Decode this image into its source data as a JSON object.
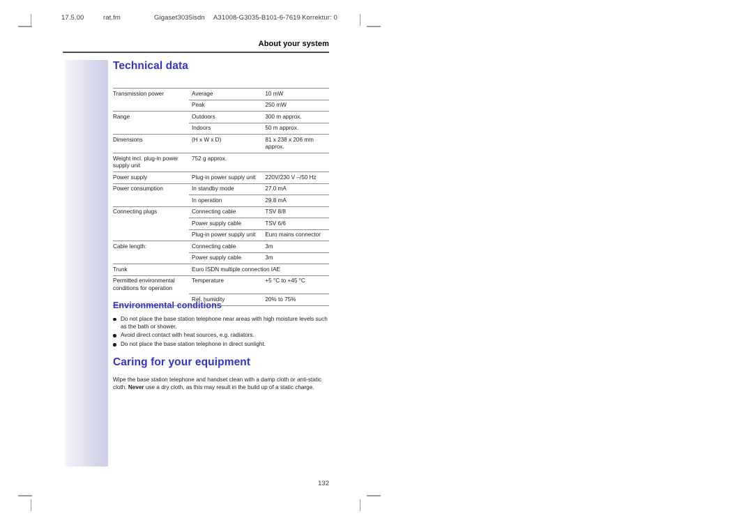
{
  "running_header": {
    "date": "17.5.00",
    "file": "rat.fm",
    "model": "Gigaset3035isdn",
    "doc_number": "A31008-G3035-B101-6-7619",
    "correction": "Korrektur: 0"
  },
  "chapter_title": "About your system",
  "page_number": "132",
  "accent_color": "#3333cc",
  "sections": {
    "technical_data": {
      "heading": "Technical data"
    },
    "environmental": {
      "heading": "Environmental conditions",
      "bullets": [
        "Do not place the base station telephone near areas with high moisture levels such as the bath or shower.",
        "Avoid direct contact with heat sources, e.g. radiators.",
        "Do not place the base station telephone in direct sunlight."
      ]
    },
    "caring": {
      "heading": "Caring for your equipment",
      "paragraph_part1": "Wipe the base station telephone and handset clean with a damp cloth or anti-static cloth. ",
      "paragraph_emphasis": "Never",
      "paragraph_part2": " use a dry cloth, as this may result in the build up of a static charge."
    }
  },
  "spec_table": {
    "rows": [
      {
        "type": "major",
        "label": "Transmission power",
        "param": "Average",
        "value": "10 mW"
      },
      {
        "type": "sub",
        "label": "",
        "param": "Peak",
        "value": "250 mW"
      },
      {
        "type": "major",
        "label": "Range",
        "param": "Outdoors",
        "value": "300 m approx."
      },
      {
        "type": "sub",
        "label": "",
        "param": "Indoors",
        "value": "50 m approx."
      },
      {
        "type": "major",
        "label": "Dimensions",
        "param": "(H x W x D)",
        "value": "81 x 238 x 206 mm approx."
      },
      {
        "type": "major",
        "label": "Weight incl. plug-in power supply unit",
        "param": "752 g approx.",
        "value": "",
        "span": true
      },
      {
        "type": "major",
        "label": "Power supply",
        "param": "Plug-in power supply unit",
        "value": "220V/230 V –/50 Hz"
      },
      {
        "type": "major",
        "label": "Power consumption",
        "param": "In standby mode",
        "value": "27.0 mA"
      },
      {
        "type": "sub",
        "label": "",
        "param": "In operation",
        "value": "29.8 mA"
      },
      {
        "type": "major",
        "label": "Connecting plugs",
        "param": "Connecting cable",
        "value": "TSV 8/8"
      },
      {
        "type": "sub",
        "label": "",
        "param": "Power supply cable",
        "value": "TSV 6/6"
      },
      {
        "type": "sub",
        "label": "",
        "param": "Plug-in power supply unit",
        "value": "Euro mains connector"
      },
      {
        "type": "major",
        "label": "Cable length:",
        "param": "Connecting cable",
        "value": "3m"
      },
      {
        "type": "sub",
        "label": "",
        "param": "Power supply cable",
        "value": "3m"
      },
      {
        "type": "major",
        "label": "Trunk",
        "param": "Euro ISDN multiple connection IAE",
        "value": "",
        "span": true
      },
      {
        "type": "major",
        "label": "Permitted environmental conditions for operation",
        "param": "Temperature",
        "value": "+5 °C to +45 °C"
      },
      {
        "type": "sub",
        "label": "",
        "param": "Rel. humidity",
        "value": "20% to 75%"
      }
    ]
  }
}
